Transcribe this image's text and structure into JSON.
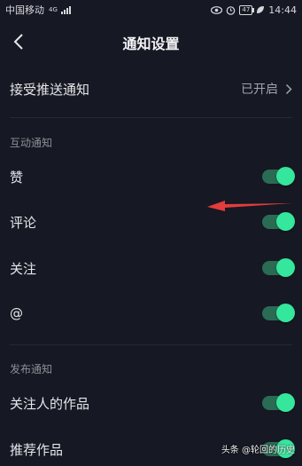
{
  "status_bar": {
    "carrier": "中国移动",
    "network": "4G",
    "battery": "47",
    "time": "14:44"
  },
  "header": {
    "title": "通知设置",
    "back_icon": "chevron-left-icon"
  },
  "push": {
    "label": "接受推送通知",
    "value": "已开启"
  },
  "sections": {
    "interaction": {
      "label": "互动通知",
      "items": [
        {
          "label": "赞",
          "on": true
        },
        {
          "label": "评论",
          "on": true
        },
        {
          "label": "关注",
          "on": true
        },
        {
          "label": "@",
          "on": true
        }
      ]
    },
    "publish": {
      "label": "发布通知",
      "items": [
        {
          "label": "关注人的作品",
          "on": true
        },
        {
          "label": "推荐作品",
          "on": true
        }
      ]
    }
  },
  "annotation": {
    "color": "#e23c3c",
    "icon": "red-arrow-left"
  },
  "colors": {
    "background": "#161823",
    "toggle_track": "#2a6b53",
    "toggle_knob": "#35e69d"
  },
  "watermark": "头条 @轮回的历史"
}
